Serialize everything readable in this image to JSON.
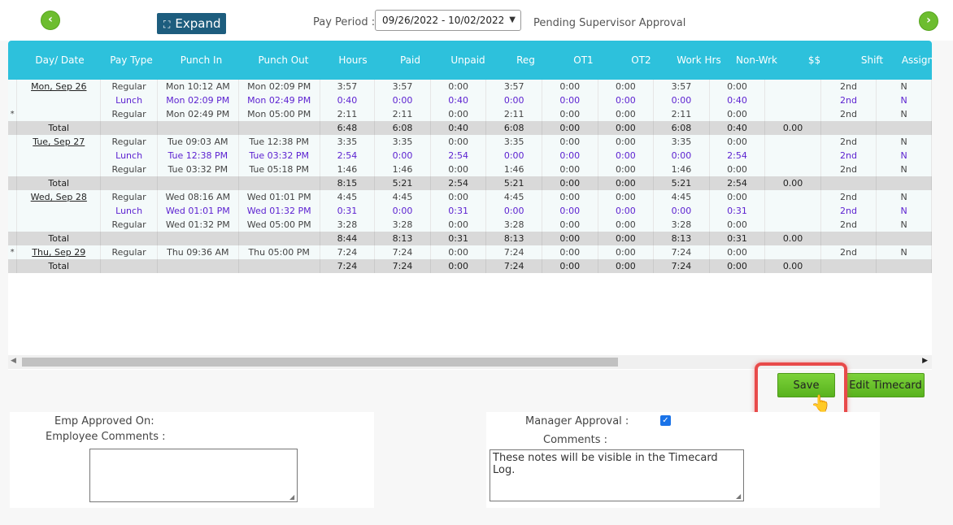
{
  "nav": {
    "prev_icon": "chevron-left-icon",
    "next_icon": "chevron-right-icon"
  },
  "expand_label": "Expand",
  "pay_period_label": "Pay Period :",
  "pay_period_value": "09/26/2022 - 10/02/2022",
  "status": "Pending Supervisor Approval",
  "columns": [
    "Day/ Date",
    "Pay Type",
    "Punch In",
    "Punch Out",
    "Hours",
    "Paid",
    "Unpaid",
    "Reg",
    "OT1",
    "OT2",
    "Work Hrs",
    "Non-Wrk",
    "$$",
    "Shift",
    "Assignme"
  ],
  "rows": [
    {
      "type": "reg",
      "mark": "",
      "day": "Mon, Sep 26",
      "cells": [
        "Regular",
        "Mon 10:12 AM",
        "Mon 02:09 PM",
        "3:57",
        "3:57",
        "0:00",
        "3:57",
        "0:00",
        "0:00",
        "3:57",
        "0:00",
        "",
        "2nd",
        "N"
      ]
    },
    {
      "type": "lunch",
      "mark": "",
      "day": "",
      "cells": [
        "Lunch",
        "Mon 02:09 PM",
        "Mon 02:49 PM",
        "0:40",
        "0:00",
        "0:40",
        "0:00",
        "0:00",
        "0:00",
        "0:00",
        "0:40",
        "",
        "2nd",
        "N"
      ]
    },
    {
      "type": "reg",
      "mark": "*",
      "day": "",
      "cells": [
        "Regular",
        "Mon 02:49 PM",
        "Mon 05:00 PM",
        "2:11",
        "2:11",
        "0:00",
        "2:11",
        "0:00",
        "0:00",
        "2:11",
        "0:00",
        "",
        "2nd",
        "N"
      ]
    },
    {
      "type": "total",
      "mark": "",
      "day": "Total",
      "cells": [
        "",
        "",
        "",
        "6:48",
        "6:08",
        "0:40",
        "6:08",
        "0:00",
        "0:00",
        "6:08",
        "0:40",
        "0.00",
        "",
        ""
      ]
    },
    {
      "type": "reg",
      "mark": "",
      "day": "Tue, Sep 27",
      "cells": [
        "Regular",
        "Tue 09:03 AM",
        "Tue 12:38 PM",
        "3:35",
        "3:35",
        "0:00",
        "3:35",
        "0:00",
        "0:00",
        "3:35",
        "0:00",
        "",
        "2nd",
        "N"
      ]
    },
    {
      "type": "lunch",
      "mark": "",
      "day": "",
      "cells": [
        "Lunch",
        "Tue 12:38 PM",
        "Tue 03:32 PM",
        "2:54",
        "0:00",
        "2:54",
        "0:00",
        "0:00",
        "0:00",
        "0:00",
        "2:54",
        "",
        "2nd",
        "N"
      ]
    },
    {
      "type": "reg",
      "mark": "",
      "day": "",
      "cells": [
        "Regular",
        "Tue 03:32 PM",
        "Tue 05:18 PM",
        "1:46",
        "1:46",
        "0:00",
        "1:46",
        "0:00",
        "0:00",
        "1:46",
        "0:00",
        "",
        "2nd",
        "N"
      ]
    },
    {
      "type": "total",
      "mark": "",
      "day": "Total",
      "cells": [
        "",
        "",
        "",
        "8:15",
        "5:21",
        "2:54",
        "5:21",
        "0:00",
        "0:00",
        "5:21",
        "2:54",
        "0.00",
        "",
        ""
      ]
    },
    {
      "type": "reg",
      "mark": "",
      "day": "Wed, Sep 28",
      "cells": [
        "Regular",
        "Wed 08:16 AM",
        "Wed 01:01 PM",
        "4:45",
        "4:45",
        "0:00",
        "4:45",
        "0:00",
        "0:00",
        "4:45",
        "0:00",
        "",
        "2nd",
        "N"
      ]
    },
    {
      "type": "lunch",
      "mark": "",
      "day": "",
      "cells": [
        "Lunch",
        "Wed 01:01 PM",
        "Wed 01:32 PM",
        "0:31",
        "0:00",
        "0:31",
        "0:00",
        "0:00",
        "0:00",
        "0:00",
        "0:31",
        "",
        "2nd",
        "N"
      ]
    },
    {
      "type": "reg",
      "mark": "",
      "day": "",
      "cells": [
        "Regular",
        "Wed 01:32 PM",
        "Wed 05:00 PM",
        "3:28",
        "3:28",
        "0:00",
        "3:28",
        "0:00",
        "0:00",
        "3:28",
        "0:00",
        "",
        "2nd",
        "N"
      ]
    },
    {
      "type": "total",
      "mark": "",
      "day": "Total",
      "cells": [
        "",
        "",
        "",
        "8:44",
        "8:13",
        "0:31",
        "8:13",
        "0:00",
        "0:00",
        "8:13",
        "0:31",
        "0.00",
        "",
        ""
      ]
    },
    {
      "type": "reg",
      "mark": "*",
      "day": "Thu, Sep 29",
      "cells": [
        "Regular",
        "Thu 09:36 AM",
        "Thu 05:00 PM",
        "7:24",
        "7:24",
        "0:00",
        "7:24",
        "0:00",
        "0:00",
        "7:24",
        "0:00",
        "",
        "2nd",
        "N"
      ]
    },
    {
      "type": "total",
      "mark": "",
      "day": "Total",
      "cells": [
        "",
        "",
        "",
        "7:24",
        "7:24",
        "0:00",
        "7:24",
        "0:00",
        "0:00",
        "7:24",
        "0:00",
        "0.00",
        "",
        ""
      ]
    }
  ],
  "buttons": {
    "save": "Save",
    "edit_timecard": "Edit Timecard"
  },
  "employee": {
    "approved_on_label": "Emp Approved On:",
    "comments_label": "Employee Comments :",
    "comments_value": ""
  },
  "manager": {
    "approval_label": "Manager Approval :",
    "approval_checked": true,
    "comments_label": "Comments :",
    "comments_value": "These notes will be visible in the Timecard Log."
  },
  "colors": {
    "header": "#2dc1dc",
    "expand_button": "#1d5d7e",
    "green_button": "#6dbd2f",
    "highlight": "#e84a4a",
    "lunch_text": "#5a1fd0"
  }
}
